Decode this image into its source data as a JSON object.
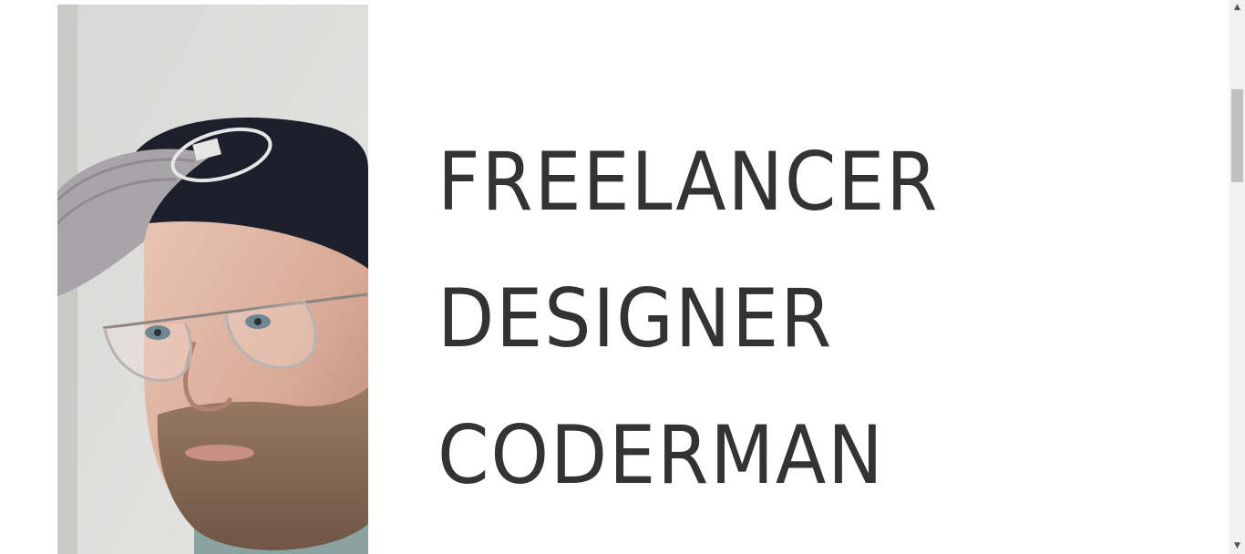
{
  "hero": {
    "portrait_alt": "portrait-photo",
    "lines": [
      "FREELANCER",
      "DESIGNER",
      "CODERMAN"
    ]
  },
  "scrollbar": {
    "up_icon": "▲",
    "down_icon": "▼"
  },
  "colors": {
    "text": "#333333",
    "background": "#ffffff",
    "scroll_track": "#f1f1f1",
    "scroll_thumb": "#c1c1c1"
  }
}
